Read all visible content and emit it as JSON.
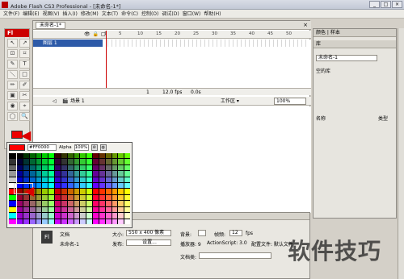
{
  "window": {
    "title": "Adobe Flash CS3 Professional - [未命名-1*]",
    "buttons": [
      "_",
      "□",
      "×"
    ]
  },
  "menubar": [
    "文件(F)",
    "编辑(E)",
    "视图(V)",
    "插入(I)",
    "修改(M)",
    "文本(T)",
    "命令(C)",
    "控制(O)",
    "调试(D)",
    "窗口(W)",
    "帮助(H)"
  ],
  "toolbox": {
    "header": "Fl",
    "tools": [
      "↖",
      "↗",
      "⊡",
      "⌑",
      "✎",
      "T",
      "＼",
      "□",
      "✏",
      "✐",
      "▣",
      "✂",
      "◉",
      "⌖",
      "◯",
      "🔍"
    ]
  },
  "document": {
    "tab": "未命名-1*",
    "timeline": {
      "ruler": [
        "1",
        "5",
        "10",
        "15",
        "20",
        "25",
        "30",
        "35",
        "40",
        "45",
        "50"
      ],
      "layer": "图层 1",
      "footer": {
        "fps": "12.0 fps",
        "time": "0.0s",
        "frame": "1"
      }
    },
    "editbar": {
      "scene": "场景 1",
      "workspace": "工作区 ▾",
      "zoom": "100%"
    }
  },
  "swatches": {
    "hex": "#FF0000",
    "alpha_label": "Alpha",
    "alpha": "100%"
  },
  "properties": {
    "tab_labels": "属性 滤镜 参数",
    "doc_label": "文档",
    "doc_name": "未命名-1",
    "size_label": "大小:",
    "size_value": "550 x 400 像素",
    "bg_label": "背景:",
    "fps_label": "帧频:",
    "fps_value": "12",
    "fps_unit": "fps",
    "publish_label": "发布:",
    "settings_btn": "设置...",
    "player_label": "播放器: 9",
    "as_label": "ActionScript: 3.0",
    "profile_label": "配置文件: 默认文件",
    "docclass_label": "文档类:"
  },
  "right_panel": {
    "header": "颜色 | 样本",
    "library": "库",
    "doc_select": "未命名-1",
    "empty": "空的库",
    "col_name": "名称",
    "col_type": "类型"
  },
  "watermark": "软件技巧"
}
